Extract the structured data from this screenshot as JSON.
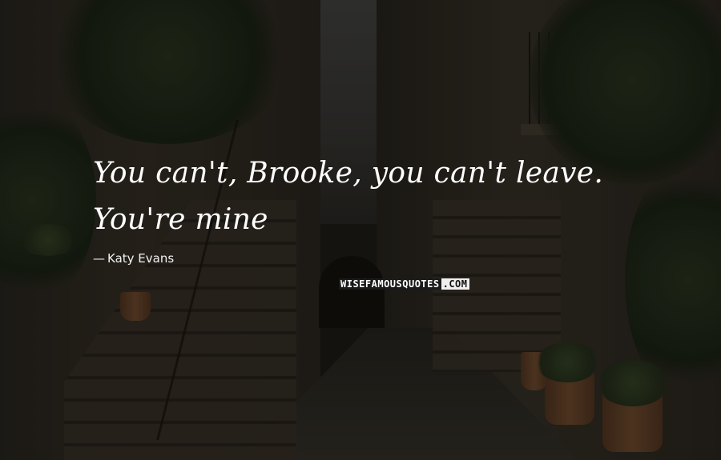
{
  "quote": {
    "text": "You can't, Brooke, you can't leave. You're mine",
    "author": "Katy Evans",
    "author_prefix": "—"
  },
  "watermark": {
    "part1": "WISEFAMOUSQUOTES",
    "part2": ".COM"
  },
  "colors": {
    "text": "#ffffff",
    "overlay": "rgba(0,0,0,0.38)"
  }
}
